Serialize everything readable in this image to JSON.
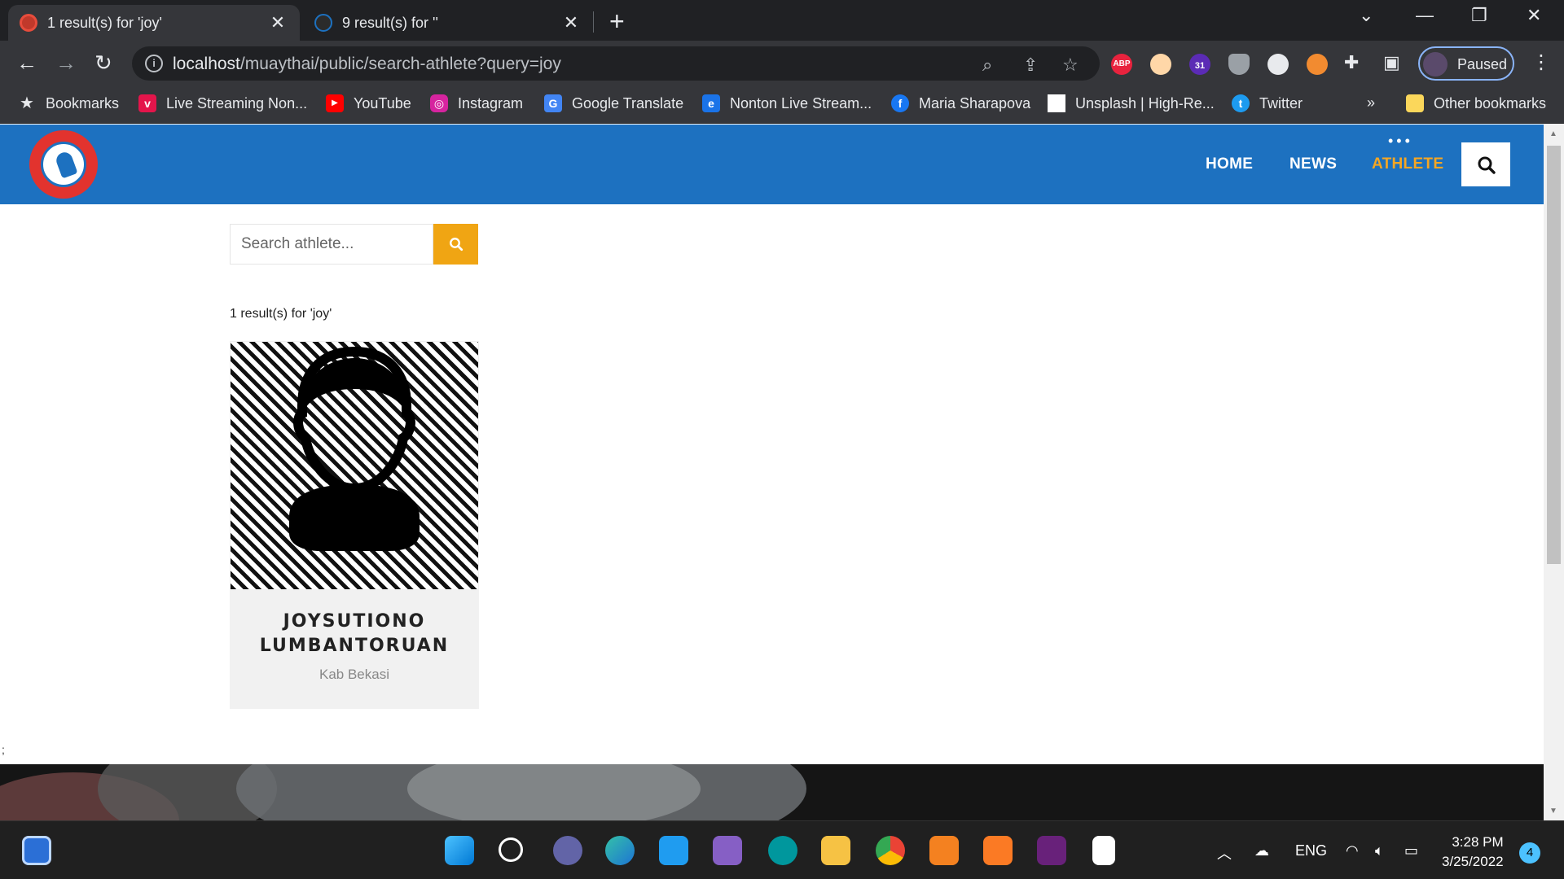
{
  "browser": {
    "tabs": [
      {
        "title": "1 result(s) for 'joy'",
        "active": true
      },
      {
        "title": "9 result(s) for ''",
        "active": false
      }
    ],
    "url_host": "localhost",
    "url_path": "/muaythai/public/search-athlete?query=joy",
    "profile_label": "Paused",
    "abp_label": "ABP",
    "calendar_badge": "31",
    "bookmarks": [
      {
        "label": "Bookmarks",
        "icon": "star-icon"
      },
      {
        "label": "Live Streaming Non...",
        "icon": "vidio-icon"
      },
      {
        "label": "YouTube",
        "icon": "youtube-icon"
      },
      {
        "label": "Instagram",
        "icon": "instagram-icon"
      },
      {
        "label": "Google Translate",
        "icon": "google-translate-icon"
      },
      {
        "label": "Nonton Live Stream...",
        "icon": "stream-icon"
      },
      {
        "label": "Maria Sharapova",
        "icon": "facebook-icon"
      },
      {
        "label": "Unsplash | High-Re...",
        "icon": "unsplash-icon"
      },
      {
        "label": "Twitter",
        "icon": "twitter-icon"
      }
    ],
    "overflow": "»",
    "other_bookmarks": "Other bookmarks"
  },
  "site": {
    "nav": [
      {
        "label": "HOME",
        "active": false
      },
      {
        "label": "NEWS",
        "active": false
      },
      {
        "label": "ATHLETE",
        "active": true
      }
    ],
    "search_placeholder": "Search athlete...",
    "results_text": "1 result(s) for 'joy'",
    "athletes": [
      {
        "name_line1": "JOYSUTIONO",
        "name_line2": "LUMBANTORUAN",
        "region": "Kab Bekasi"
      }
    ],
    "stray_text": ";"
  },
  "taskbar": {
    "language": "ENG",
    "time": "3:28 PM",
    "date": "3/25/2022",
    "notifications": "4"
  },
  "colors": {
    "header": "#1d71c0",
    "accent": "#f0a513",
    "chrome_bg": "#35363a"
  }
}
